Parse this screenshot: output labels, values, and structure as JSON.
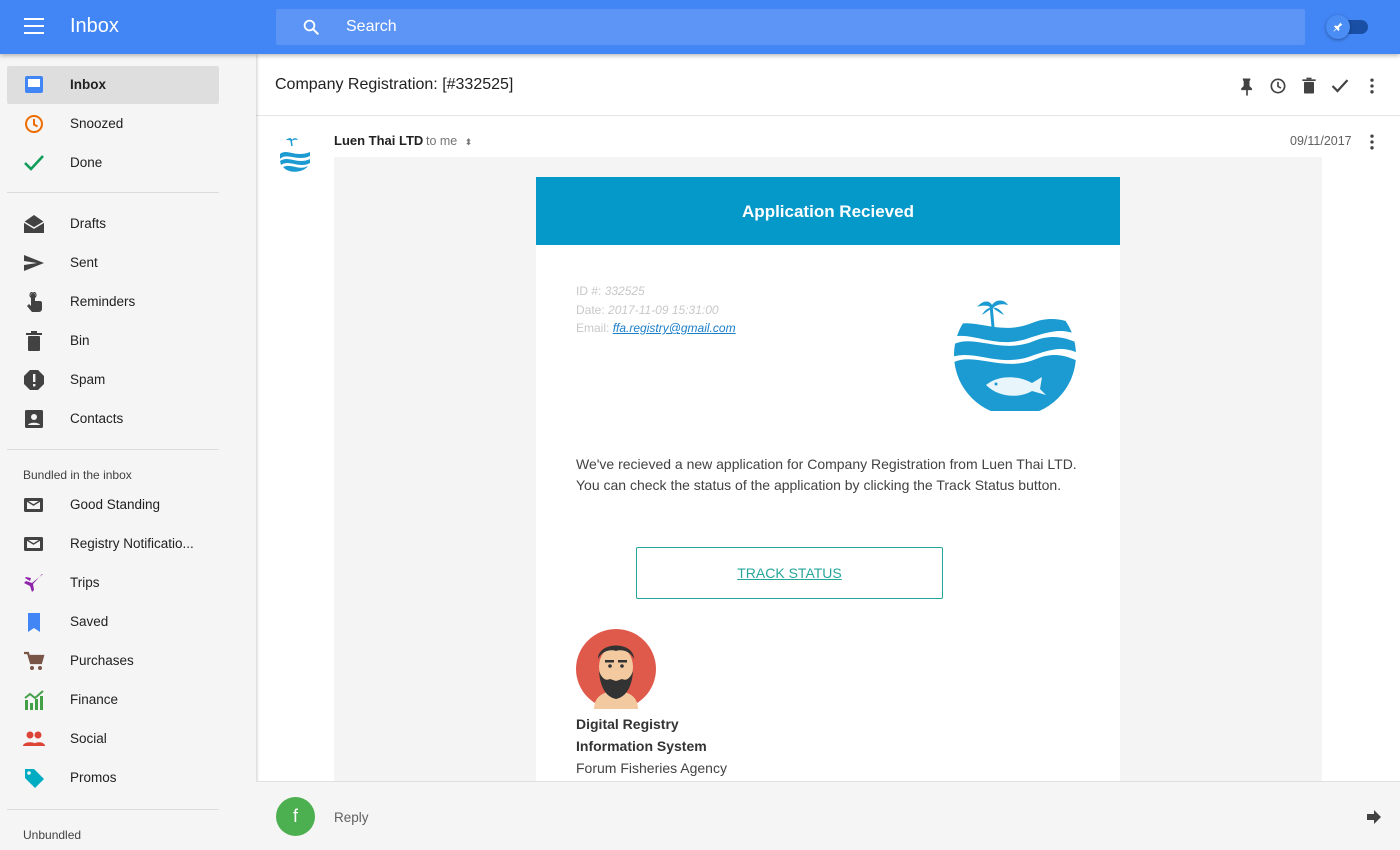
{
  "header": {
    "menu_icon": "hamburger-icon",
    "title": "Inbox",
    "search_placeholder": "Search",
    "toggle_icon": "pin-icon",
    "accent_color": "#4285f4"
  },
  "sidebar": {
    "primary": [
      {
        "label": "Inbox",
        "icon": "inbox-icon",
        "color": "#4285f4",
        "active": true
      },
      {
        "label": "Snoozed",
        "icon": "clock-icon",
        "color": "#ef6c00"
      },
      {
        "label": "Done",
        "icon": "check-icon",
        "color": "#0f9d58"
      }
    ],
    "system": [
      {
        "label": "Drafts",
        "icon": "drafts-icon"
      },
      {
        "label": "Sent",
        "icon": "send-icon"
      },
      {
        "label": "Reminders",
        "icon": "reminder-hand-icon"
      },
      {
        "label": "Bin",
        "icon": "trash-icon"
      },
      {
        "label": "Spam",
        "icon": "spam-icon"
      },
      {
        "label": "Contacts",
        "icon": "contacts-icon"
      }
    ],
    "bundled_header": "Bundled in the inbox",
    "bundles": [
      {
        "label": "Good Standing",
        "icon": "bundle-mail-icon"
      },
      {
        "label": "Registry Notificatio...",
        "icon": "bundle-mail-icon"
      },
      {
        "label": "Trips",
        "icon": "plane-icon",
        "color": "#8e24aa"
      },
      {
        "label": "Saved",
        "icon": "bookmark-icon",
        "color": "#4285f4"
      },
      {
        "label": "Purchases",
        "icon": "cart-icon",
        "color": "#795548"
      },
      {
        "label": "Finance",
        "icon": "finance-chart-icon",
        "color": "#43a047"
      },
      {
        "label": "Social",
        "icon": "people-icon",
        "color": "#db4437"
      },
      {
        "label": "Promos",
        "icon": "tag-icon",
        "color": "#00acc1"
      }
    ],
    "unbundled_header": "Unbundled"
  },
  "thread": {
    "subject": "Company Registration: [#332525]",
    "actions": [
      "pin-icon",
      "snooze-clock-icon",
      "trash-icon",
      "done-check-icon",
      "more-vert-icon"
    ],
    "sender": "Luen Thai LTD",
    "to": "to me",
    "date": "09/11/2017"
  },
  "email": {
    "header_title": "Application Recieved",
    "header_color": "#0499c8",
    "id_label": "ID #:",
    "id_value": "332525",
    "date_label": "Date:",
    "date_value": "2017-11-09 15:31:00",
    "email_label": "Email:",
    "email_value": "ffa.registry@gmail.com",
    "body": "We've recieved a new application for Company Registration from Luen Thai LTD. You can check the status of the application by clicking the Track Status button.",
    "button_label": "TRACK STATUS",
    "button_color": "#26a69a",
    "signature": {
      "line1": "Digital Registry",
      "line2": "Information System",
      "line3": "Forum Fisheries Agency"
    }
  },
  "reply": {
    "avatar_letter": "f",
    "avatar_color": "#4caf50",
    "label": "Reply"
  }
}
